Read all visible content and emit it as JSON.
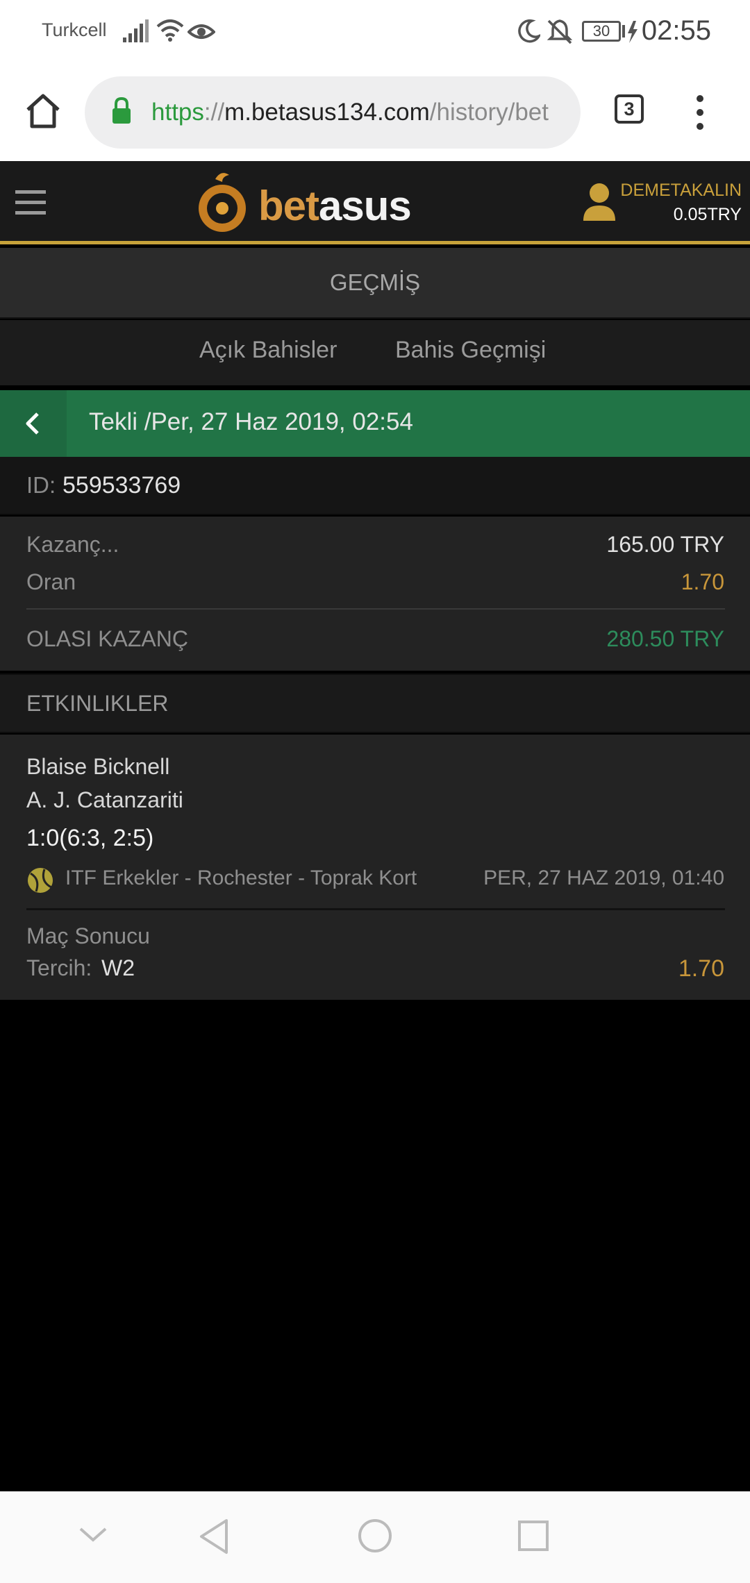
{
  "status_bar": {
    "carrier": "Turkcell",
    "battery": "30",
    "time": "02:55"
  },
  "browser": {
    "url_scheme": "https",
    "url_sep": "://",
    "url_host": "m.betasus134.com",
    "url_path": "/history/bet",
    "tab_count": "3"
  },
  "header": {
    "logo_text_a": "bet",
    "logo_text_b": "asus",
    "username": "DEMETAKALIN",
    "balance": "0.05TRY"
  },
  "page": {
    "title": "GEÇMİŞ",
    "tabs": [
      {
        "label": "Açık Bahisler"
      },
      {
        "label": "Bahis Geçmişi"
      }
    ]
  },
  "bet": {
    "header": "Tekli /Per, 27 Haz 2019, 02:54",
    "id_label": "ID:",
    "id_value": "559533769",
    "stake_label": "Kazanç...",
    "stake_value": "165.00 TRY",
    "odds_label": "Oran",
    "odds_value": "1.70",
    "potential_label": "OLASI KAZANÇ",
    "potential_value": "280.50 TRY"
  },
  "events": {
    "header": "ETKINLIKLER",
    "items": [
      {
        "team1": "Blaise Bicknell",
        "team2": "A. J. Catanzariti",
        "score": "1:0(6:3, 2:5)",
        "league": "ITF Erkekler - Rochester - Toprak Kort",
        "date": "PER, 27 HAZ 2019, 01:40",
        "market": "Maç Sonucu",
        "pick_label": "Tercih:",
        "pick_value": "W2",
        "odds": "1.70"
      }
    ]
  },
  "colors": {
    "accent_gold": "#c9a03b",
    "green_header": "#217446",
    "potential_green": "#2d8c5c",
    "odds_orange": "#c8963a"
  }
}
